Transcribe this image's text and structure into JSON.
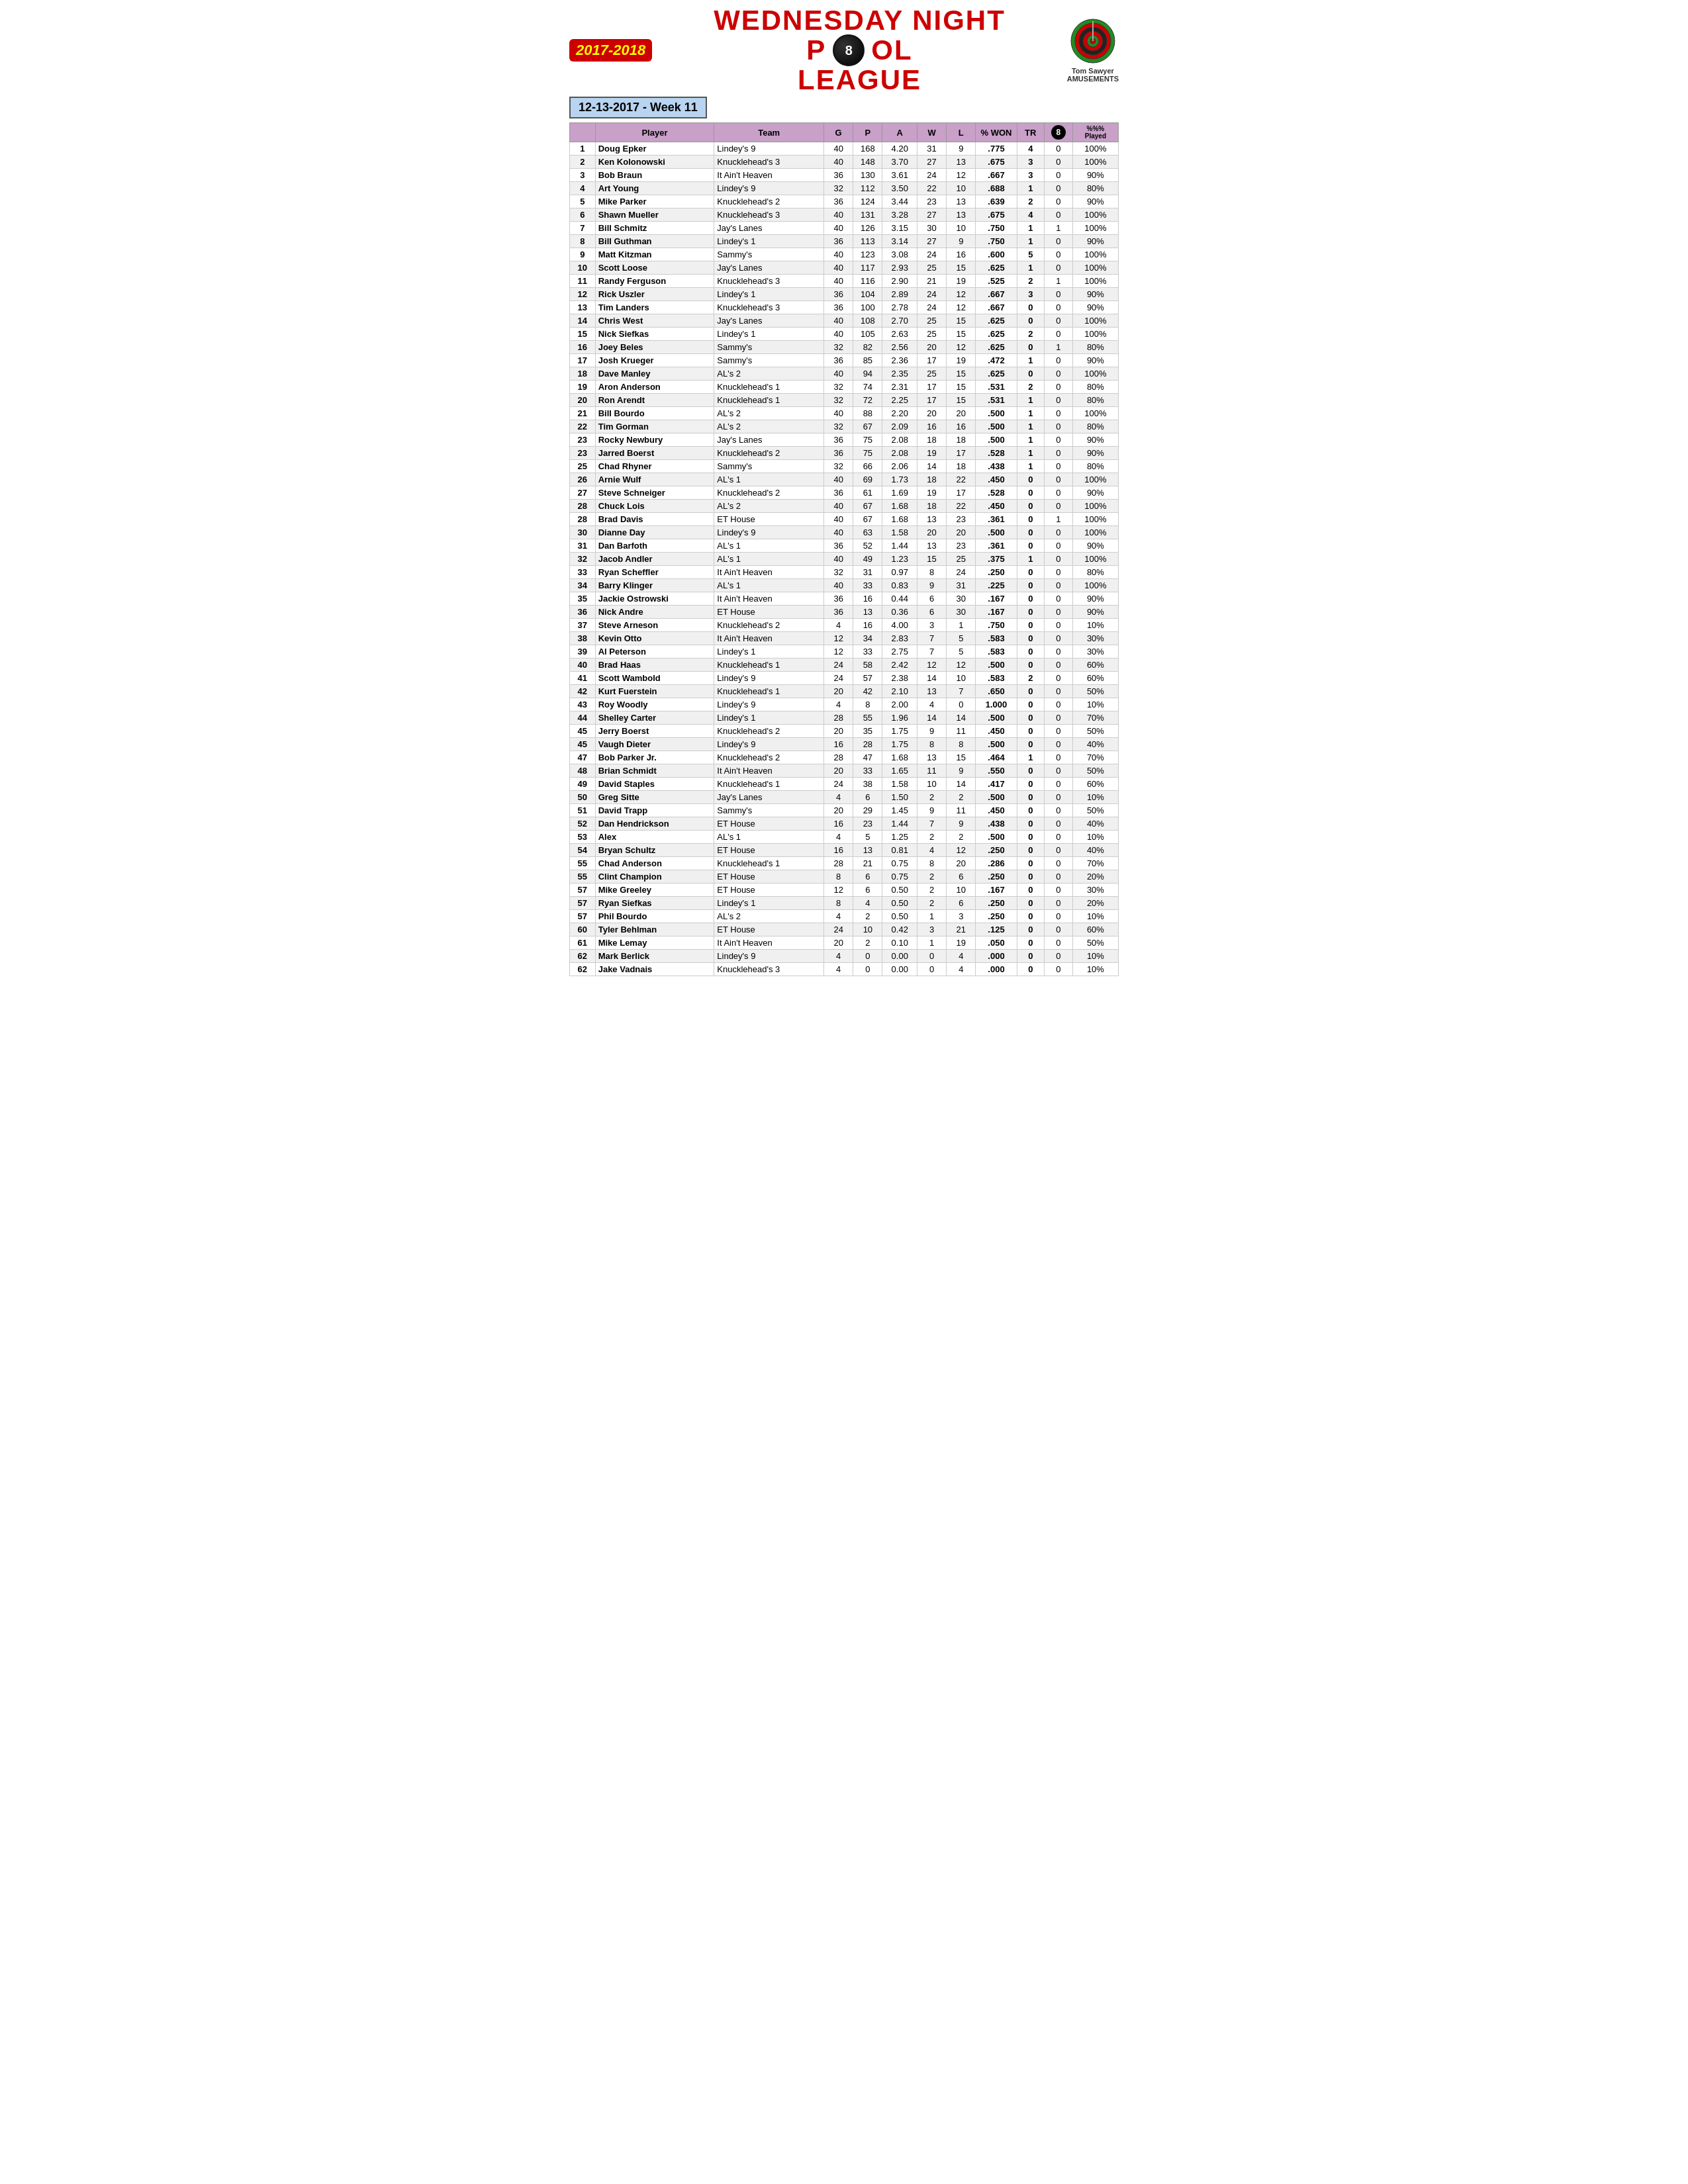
{
  "header": {
    "year": "2017-2018",
    "title_line1": "WEDNESDAY NIGHT",
    "title_line2a": "P",
    "title_ball": "8",
    "title_line2b": "L",
    "title_line3": "LEAGUE",
    "week": "12-13-2017 - Week 11",
    "logo_name": "Tom Sawyer",
    "logo_sub": "AMUSEMENTS"
  },
  "columns": {
    "rank": "#",
    "player": "Player",
    "team": "Team",
    "g": "G",
    "p": "P",
    "a": "A",
    "w": "W",
    "l": "L",
    "pct_won": "% WON",
    "tr": "TR",
    "eight_ball": "8",
    "pct_played": "%%% Played"
  },
  "rows": [
    {
      "rank": "1",
      "player": "Doug Epker",
      "team": "Lindey's 9",
      "g": "40",
      "p": "168",
      "a": "4.20",
      "w": "31",
      "l": "9",
      "pct": ".775",
      "tr": "4",
      "eight": "0",
      "played": "100%"
    },
    {
      "rank": "2",
      "player": "Ken Kolonowski",
      "team": "Knucklehead's 3",
      "g": "40",
      "p": "148",
      "a": "3.70",
      "w": "27",
      "l": "13",
      "pct": ".675",
      "tr": "3",
      "eight": "0",
      "played": "100%"
    },
    {
      "rank": "3",
      "player": "Bob Braun",
      "team": "It Ain't Heaven",
      "g": "36",
      "p": "130",
      "a": "3.61",
      "w": "24",
      "l": "12",
      "pct": ".667",
      "tr": "3",
      "eight": "0",
      "played": "90%"
    },
    {
      "rank": "4",
      "player": "Art Young",
      "team": "Lindey's 9",
      "g": "32",
      "p": "112",
      "a": "3.50",
      "w": "22",
      "l": "10",
      "pct": ".688",
      "tr": "1",
      "eight": "0",
      "played": "80%"
    },
    {
      "rank": "5",
      "player": "Mike Parker",
      "team": "Knucklehead's 2",
      "g": "36",
      "p": "124",
      "a": "3.44",
      "w": "23",
      "l": "13",
      "pct": ".639",
      "tr": "2",
      "eight": "0",
      "played": "90%"
    },
    {
      "rank": "6",
      "player": "Shawn Mueller",
      "team": "Knucklehead's 3",
      "g": "40",
      "p": "131",
      "a": "3.28",
      "w": "27",
      "l": "13",
      "pct": ".675",
      "tr": "4",
      "eight": "0",
      "played": "100%"
    },
    {
      "rank": "7",
      "player": "Bill Schmitz",
      "team": "Jay's Lanes",
      "g": "40",
      "p": "126",
      "a": "3.15",
      "w": "30",
      "l": "10",
      "pct": ".750",
      "tr": "1",
      "eight": "1",
      "played": "100%"
    },
    {
      "rank": "8",
      "player": "Bill Guthman",
      "team": "Lindey's 1",
      "g": "36",
      "p": "113",
      "a": "3.14",
      "w": "27",
      "l": "9",
      "pct": ".750",
      "tr": "1",
      "eight": "0",
      "played": "90%"
    },
    {
      "rank": "9",
      "player": "Matt Kitzman",
      "team": "Sammy's",
      "g": "40",
      "p": "123",
      "a": "3.08",
      "w": "24",
      "l": "16",
      "pct": ".600",
      "tr": "5",
      "eight": "0",
      "played": "100%"
    },
    {
      "rank": "10",
      "player": "Scott Loose",
      "team": "Jay's Lanes",
      "g": "40",
      "p": "117",
      "a": "2.93",
      "w": "25",
      "l": "15",
      "pct": ".625",
      "tr": "1",
      "eight": "0",
      "played": "100%"
    },
    {
      "rank": "11",
      "player": "Randy Ferguson",
      "team": "Knucklehead's 3",
      "g": "40",
      "p": "116",
      "a": "2.90",
      "w": "21",
      "l": "19",
      "pct": ".525",
      "tr": "2",
      "eight": "1",
      "played": "100%"
    },
    {
      "rank": "12",
      "player": "Rick Uszler",
      "team": "Lindey's 1",
      "g": "36",
      "p": "104",
      "a": "2.89",
      "w": "24",
      "l": "12",
      "pct": ".667",
      "tr": "3",
      "eight": "0",
      "played": "90%"
    },
    {
      "rank": "13",
      "player": "Tim Landers",
      "team": "Knucklehead's 3",
      "g": "36",
      "p": "100",
      "a": "2.78",
      "w": "24",
      "l": "12",
      "pct": ".667",
      "tr": "0",
      "eight": "0",
      "played": "90%"
    },
    {
      "rank": "14",
      "player": "Chris West",
      "team": "Jay's Lanes",
      "g": "40",
      "p": "108",
      "a": "2.70",
      "w": "25",
      "l": "15",
      "pct": ".625",
      "tr": "0",
      "eight": "0",
      "played": "100%"
    },
    {
      "rank": "15",
      "player": "Nick Siefkas",
      "team": "Lindey's 1",
      "g": "40",
      "p": "105",
      "a": "2.63",
      "w": "25",
      "l": "15",
      "pct": ".625",
      "tr": "2",
      "eight": "0",
      "played": "100%"
    },
    {
      "rank": "16",
      "player": "Joey Beles",
      "team": "Sammy's",
      "g": "32",
      "p": "82",
      "a": "2.56",
      "w": "20",
      "l": "12",
      "pct": ".625",
      "tr": "0",
      "eight": "1",
      "played": "80%"
    },
    {
      "rank": "17",
      "player": "Josh Krueger",
      "team": "Sammy's",
      "g": "36",
      "p": "85",
      "a": "2.36",
      "w": "17",
      "l": "19",
      "pct": ".472",
      "tr": "1",
      "eight": "0",
      "played": "90%"
    },
    {
      "rank": "18",
      "player": "Dave Manley",
      "team": "AL's 2",
      "g": "40",
      "p": "94",
      "a": "2.35",
      "w": "25",
      "l": "15",
      "pct": ".625",
      "tr": "0",
      "eight": "0",
      "played": "100%"
    },
    {
      "rank": "19",
      "player": "Aron Anderson",
      "team": "Knucklehead's 1",
      "g": "32",
      "p": "74",
      "a": "2.31",
      "w": "17",
      "l": "15",
      "pct": ".531",
      "tr": "2",
      "eight": "0",
      "played": "80%"
    },
    {
      "rank": "20",
      "player": "Ron Arendt",
      "team": "Knucklehead's 1",
      "g": "32",
      "p": "72",
      "a": "2.25",
      "w": "17",
      "l": "15",
      "pct": ".531",
      "tr": "1",
      "eight": "0",
      "played": "80%"
    },
    {
      "rank": "21",
      "player": "Bill Bourdo",
      "team": "AL's 2",
      "g": "40",
      "p": "88",
      "a": "2.20",
      "w": "20",
      "l": "20",
      "pct": ".500",
      "tr": "1",
      "eight": "0",
      "played": "100%"
    },
    {
      "rank": "22",
      "player": "Tim Gorman",
      "team": "AL's 2",
      "g": "32",
      "p": "67",
      "a": "2.09",
      "w": "16",
      "l": "16",
      "pct": ".500",
      "tr": "1",
      "eight": "0",
      "played": "80%"
    },
    {
      "rank": "23",
      "player": "Rocky Newbury",
      "team": "Jay's Lanes",
      "g": "36",
      "p": "75",
      "a": "2.08",
      "w": "18",
      "l": "18",
      "pct": ".500",
      "tr": "1",
      "eight": "0",
      "played": "90%"
    },
    {
      "rank": "23",
      "player": "Jarred Boerst",
      "team": "Knucklehead's 2",
      "g": "36",
      "p": "75",
      "a": "2.08",
      "w": "19",
      "l": "17",
      "pct": ".528",
      "tr": "1",
      "eight": "0",
      "played": "90%"
    },
    {
      "rank": "25",
      "player": "Chad Rhyner",
      "team": "Sammy's",
      "g": "32",
      "p": "66",
      "a": "2.06",
      "w": "14",
      "l": "18",
      "pct": ".438",
      "tr": "1",
      "eight": "0",
      "played": "80%"
    },
    {
      "rank": "26",
      "player": "Arnie Wulf",
      "team": "AL's 1",
      "g": "40",
      "p": "69",
      "a": "1.73",
      "w": "18",
      "l": "22",
      "pct": ".450",
      "tr": "0",
      "eight": "0",
      "played": "100%"
    },
    {
      "rank": "27",
      "player": "Steve Schneiger",
      "team": "Knucklehead's 2",
      "g": "36",
      "p": "61",
      "a": "1.69",
      "w": "19",
      "l": "17",
      "pct": ".528",
      "tr": "0",
      "eight": "0",
      "played": "90%"
    },
    {
      "rank": "28",
      "player": "Chuck Lois",
      "team": "AL's 2",
      "g": "40",
      "p": "67",
      "a": "1.68",
      "w": "18",
      "l": "22",
      "pct": ".450",
      "tr": "0",
      "eight": "0",
      "played": "100%"
    },
    {
      "rank": "28",
      "player": "Brad Davis",
      "team": "ET House",
      "g": "40",
      "p": "67",
      "a": "1.68",
      "w": "13",
      "l": "23",
      "pct": ".361",
      "tr": "0",
      "eight": "1",
      "played": "100%"
    },
    {
      "rank": "30",
      "player": "Dianne Day",
      "team": "Lindey's 9",
      "g": "40",
      "p": "63",
      "a": "1.58",
      "w": "20",
      "l": "20",
      "pct": ".500",
      "tr": "0",
      "eight": "0",
      "played": "100%"
    },
    {
      "rank": "31",
      "player": "Dan Barfoth",
      "team": "AL's 1",
      "g": "36",
      "p": "52",
      "a": "1.44",
      "w": "13",
      "l": "23",
      "pct": ".361",
      "tr": "0",
      "eight": "0",
      "played": "90%"
    },
    {
      "rank": "32",
      "player": "Jacob Andler",
      "team": "AL's 1",
      "g": "40",
      "p": "49",
      "a": "1.23",
      "w": "15",
      "l": "25",
      "pct": ".375",
      "tr": "1",
      "eight": "0",
      "played": "100%"
    },
    {
      "rank": "33",
      "player": "Ryan Scheffler",
      "team": "It Ain't Heaven",
      "g": "32",
      "p": "31",
      "a": "0.97",
      "w": "8",
      "l": "24",
      "pct": ".250",
      "tr": "0",
      "eight": "0",
      "played": "80%"
    },
    {
      "rank": "34",
      "player": "Barry Klinger",
      "team": "AL's 1",
      "g": "40",
      "p": "33",
      "a": "0.83",
      "w": "9",
      "l": "31",
      "pct": ".225",
      "tr": "0",
      "eight": "0",
      "played": "100%"
    },
    {
      "rank": "35",
      "player": "Jackie Ostrowski",
      "team": "It Ain't Heaven",
      "g": "36",
      "p": "16",
      "a": "0.44",
      "w": "6",
      "l": "30",
      "pct": ".167",
      "tr": "0",
      "eight": "0",
      "played": "90%"
    },
    {
      "rank": "36",
      "player": "Nick Andre",
      "team": "ET House",
      "g": "36",
      "p": "13",
      "a": "0.36",
      "w": "6",
      "l": "30",
      "pct": ".167",
      "tr": "0",
      "eight": "0",
      "played": "90%"
    },
    {
      "rank": "37",
      "player": "Steve Arneson",
      "team": "Knucklehead's 2",
      "g": "4",
      "p": "16",
      "a": "4.00",
      "w": "3",
      "l": "1",
      "pct": ".750",
      "tr": "0",
      "eight": "0",
      "played": "10%"
    },
    {
      "rank": "38",
      "player": "Kevin Otto",
      "team": "It Ain't Heaven",
      "g": "12",
      "p": "34",
      "a": "2.83",
      "w": "7",
      "l": "5",
      "pct": ".583",
      "tr": "0",
      "eight": "0",
      "played": "30%"
    },
    {
      "rank": "39",
      "player": "Al Peterson",
      "team": "Lindey's 1",
      "g": "12",
      "p": "33",
      "a": "2.75",
      "w": "7",
      "l": "5",
      "pct": ".583",
      "tr": "0",
      "eight": "0",
      "played": "30%"
    },
    {
      "rank": "40",
      "player": "Brad Haas",
      "team": "Knucklehead's 1",
      "g": "24",
      "p": "58",
      "a": "2.42",
      "w": "12",
      "l": "12",
      "pct": ".500",
      "tr": "0",
      "eight": "0",
      "played": "60%"
    },
    {
      "rank": "41",
      "player": "Scott Wambold",
      "team": "Lindey's 9",
      "g": "24",
      "p": "57",
      "a": "2.38",
      "w": "14",
      "l": "10",
      "pct": ".583",
      "tr": "2",
      "eight": "0",
      "played": "60%"
    },
    {
      "rank": "42",
      "player": "Kurt Fuerstein",
      "team": "Knucklehead's 1",
      "g": "20",
      "p": "42",
      "a": "2.10",
      "w": "13",
      "l": "7",
      "pct": ".650",
      "tr": "0",
      "eight": "0",
      "played": "50%"
    },
    {
      "rank": "43",
      "player": "Roy Woodly",
      "team": "Lindey's 9",
      "g": "4",
      "p": "8",
      "a": "2.00",
      "w": "4",
      "l": "0",
      "pct": "1.000",
      "tr": "0",
      "eight": "0",
      "played": "10%"
    },
    {
      "rank": "44",
      "player": "Shelley Carter",
      "team": "Lindey's 1",
      "g": "28",
      "p": "55",
      "a": "1.96",
      "w": "14",
      "l": "14",
      "pct": ".500",
      "tr": "0",
      "eight": "0",
      "played": "70%"
    },
    {
      "rank": "45",
      "player": "Jerry Boerst",
      "team": "Knucklehead's 2",
      "g": "20",
      "p": "35",
      "a": "1.75",
      "w": "9",
      "l": "11",
      "pct": ".450",
      "tr": "0",
      "eight": "0",
      "played": "50%"
    },
    {
      "rank": "45",
      "player": "Vaugh Dieter",
      "team": "Lindey's 9",
      "g": "16",
      "p": "28",
      "a": "1.75",
      "w": "8",
      "l": "8",
      "pct": ".500",
      "tr": "0",
      "eight": "0",
      "played": "40%"
    },
    {
      "rank": "47",
      "player": "Bob Parker Jr.",
      "team": "Knucklehead's 2",
      "g": "28",
      "p": "47",
      "a": "1.68",
      "w": "13",
      "l": "15",
      "pct": ".464",
      "tr": "1",
      "eight": "0",
      "played": "70%"
    },
    {
      "rank": "48",
      "player": "Brian Schmidt",
      "team": "It Ain't Heaven",
      "g": "20",
      "p": "33",
      "a": "1.65",
      "w": "11",
      "l": "9",
      "pct": ".550",
      "tr": "0",
      "eight": "0",
      "played": "50%"
    },
    {
      "rank": "49",
      "player": "David Staples",
      "team": "Knucklehead's 1",
      "g": "24",
      "p": "38",
      "a": "1.58",
      "w": "10",
      "l": "14",
      "pct": ".417",
      "tr": "0",
      "eight": "0",
      "played": "60%"
    },
    {
      "rank": "50",
      "player": "Greg Sitte",
      "team": "Jay's Lanes",
      "g": "4",
      "p": "6",
      "a": "1.50",
      "w": "2",
      "l": "2",
      "pct": ".500",
      "tr": "0",
      "eight": "0",
      "played": "10%"
    },
    {
      "rank": "51",
      "player": "David Trapp",
      "team": "Sammy's",
      "g": "20",
      "p": "29",
      "a": "1.45",
      "w": "9",
      "l": "11",
      "pct": ".450",
      "tr": "0",
      "eight": "0",
      "played": "50%"
    },
    {
      "rank": "52",
      "player": "Dan Hendrickson",
      "team": "ET House",
      "g": "16",
      "p": "23",
      "a": "1.44",
      "w": "7",
      "l": "9",
      "pct": ".438",
      "tr": "0",
      "eight": "0",
      "played": "40%"
    },
    {
      "rank": "53",
      "player": "Alex",
      "team": "AL's 1",
      "g": "4",
      "p": "5",
      "a": "1.25",
      "w": "2",
      "l": "2",
      "pct": ".500",
      "tr": "0",
      "eight": "0",
      "played": "10%"
    },
    {
      "rank": "54",
      "player": "Bryan Schultz",
      "team": "ET House",
      "g": "16",
      "p": "13",
      "a": "0.81",
      "w": "4",
      "l": "12",
      "pct": ".250",
      "tr": "0",
      "eight": "0",
      "played": "40%"
    },
    {
      "rank": "55",
      "player": "Chad Anderson",
      "team": "Knucklehead's 1",
      "g": "28",
      "p": "21",
      "a": "0.75",
      "w": "8",
      "l": "20",
      "pct": ".286",
      "tr": "0",
      "eight": "0",
      "played": "70%"
    },
    {
      "rank": "55",
      "player": "Clint Champion",
      "team": "ET House",
      "g": "8",
      "p": "6",
      "a": "0.75",
      "w": "2",
      "l": "6",
      "pct": ".250",
      "tr": "0",
      "eight": "0",
      "played": "20%"
    },
    {
      "rank": "57",
      "player": "Mike Greeley",
      "team": "ET House",
      "g": "12",
      "p": "6",
      "a": "0.50",
      "w": "2",
      "l": "10",
      "pct": ".167",
      "tr": "0",
      "eight": "0",
      "played": "30%"
    },
    {
      "rank": "57",
      "player": "Ryan Siefkas",
      "team": "Lindey's 1",
      "g": "8",
      "p": "4",
      "a": "0.50",
      "w": "2",
      "l": "6",
      "pct": ".250",
      "tr": "0",
      "eight": "0",
      "played": "20%"
    },
    {
      "rank": "57",
      "player": "Phil Bourdo",
      "team": "AL's 2",
      "g": "4",
      "p": "2",
      "a": "0.50",
      "w": "1",
      "l": "3",
      "pct": ".250",
      "tr": "0",
      "eight": "0",
      "played": "10%"
    },
    {
      "rank": "60",
      "player": "Tyler Behlman",
      "team": "ET House",
      "g": "24",
      "p": "10",
      "a": "0.42",
      "w": "3",
      "l": "21",
      "pct": ".125",
      "tr": "0",
      "eight": "0",
      "played": "60%"
    },
    {
      "rank": "61",
      "player": "Mike Lemay",
      "team": "It Ain't Heaven",
      "g": "20",
      "p": "2",
      "a": "0.10",
      "w": "1",
      "l": "19",
      "pct": ".050",
      "tr": "0",
      "eight": "0",
      "played": "50%"
    },
    {
      "rank": "62",
      "player": "Mark Berlick",
      "team": "Lindey's 9",
      "g": "4",
      "p": "0",
      "a": "0.00",
      "w": "0",
      "l": "4",
      "pct": ".000",
      "tr": "0",
      "eight": "0",
      "played": "10%"
    },
    {
      "rank": "62",
      "player": "Jake Vadnais",
      "team": "Knucklehead's 3",
      "g": "4",
      "p": "0",
      "a": "0.00",
      "w": "0",
      "l": "4",
      "pct": ".000",
      "tr": "0",
      "eight": "0",
      "played": "10%"
    }
  ]
}
